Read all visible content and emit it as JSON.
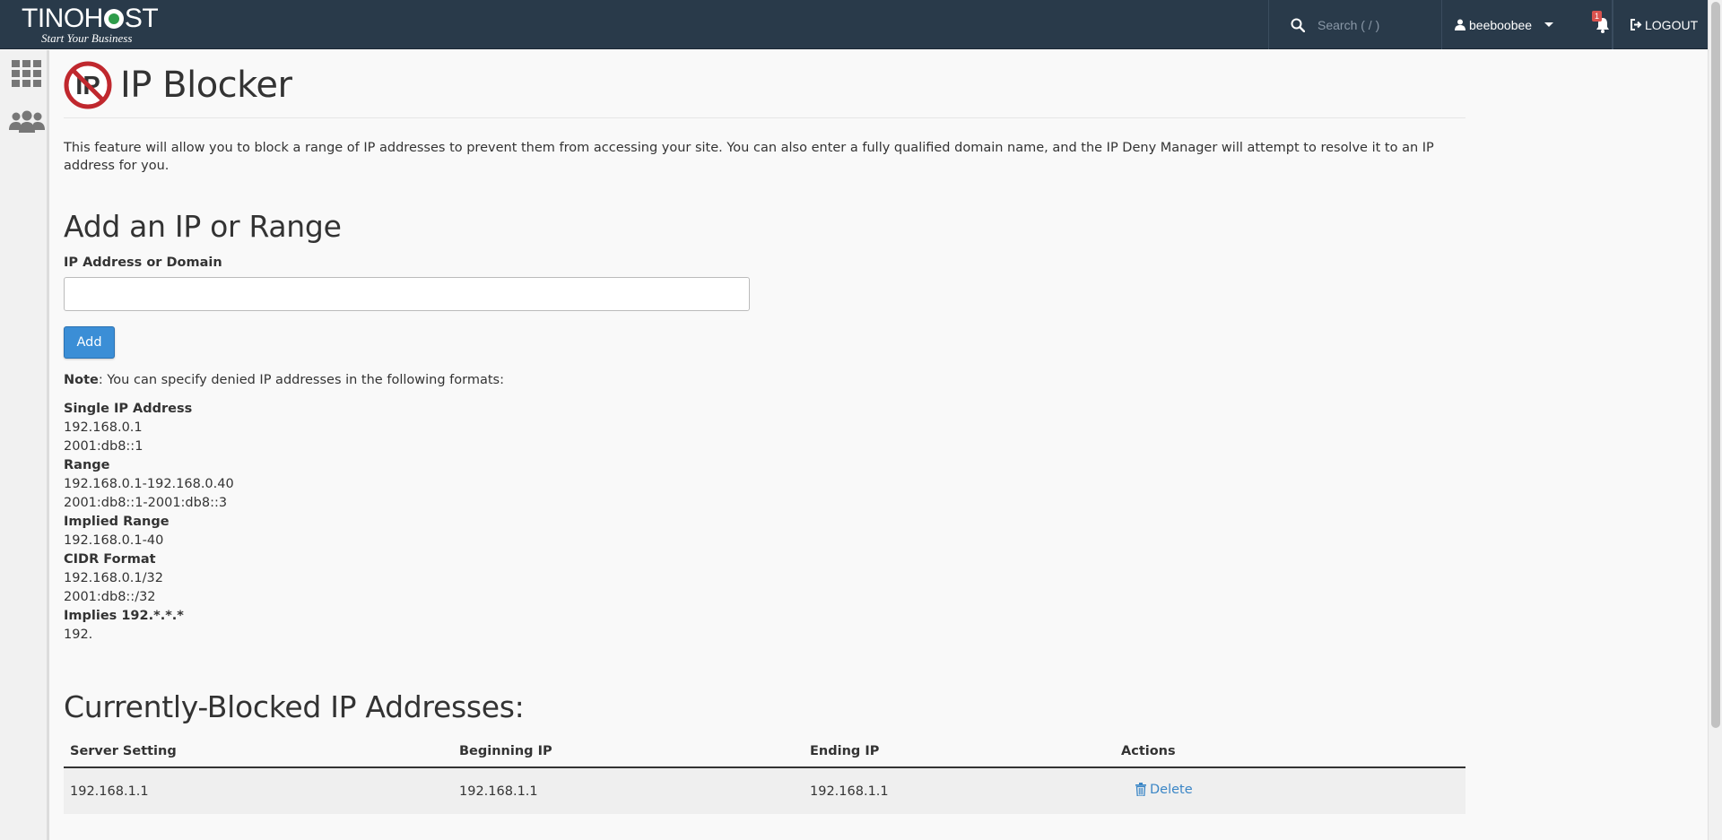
{
  "header": {
    "logo_text": "TINOHOST",
    "logo_tagline": "Start Your Business",
    "search_placeholder": "Search ( / )",
    "username": "beeboobee",
    "notification_count": "1",
    "logout_label": "LOGOUT"
  },
  "page": {
    "title": "IP Blocker",
    "description": "This feature will allow you to block a range of IP addresses to prevent them from accessing your site. You can also enter a fully qualified domain name, and the IP Deny Manager will attempt to resolve it to an IP address for you."
  },
  "form": {
    "heading": "Add an IP or Range",
    "field_label": "IP Address or Domain",
    "field_value": "",
    "add_button": "Add"
  },
  "note": {
    "label": "Note",
    "text": ": You can specify denied IP addresses in the following formats:"
  },
  "formats": [
    {
      "heading": "Single IP Address",
      "examples": [
        "192.168.0.1",
        "2001:db8::1"
      ]
    },
    {
      "heading": "Range",
      "examples": [
        "192.168.0.1-192.168.0.40",
        "2001:db8::1-2001:db8::3"
      ]
    },
    {
      "heading": "Implied Range",
      "examples": [
        "192.168.0.1-40"
      ]
    },
    {
      "heading": "CIDR Format",
      "examples": [
        "192.168.0.1/32",
        "2001:db8::/32"
      ]
    },
    {
      "heading": "Implies 192.*.*.*",
      "examples": [
        "192."
      ]
    }
  ],
  "blocked": {
    "heading": "Currently-Blocked IP Addresses:",
    "columns": [
      "Server Setting",
      "Beginning IP",
      "Ending IP",
      "Actions"
    ],
    "rows": [
      {
        "server_setting": "192.168.1.1",
        "beginning_ip": "192.168.1.1",
        "ending_ip": "192.168.1.1",
        "action": "Delete"
      }
    ]
  },
  "icons": {
    "search": "search-icon",
    "user": "user-icon",
    "bell": "bell-icon",
    "logout": "logout-icon",
    "apps": "grid-icon",
    "users": "users-icon",
    "ip_blocker": "ip-blocker-icon",
    "trash": "trash-icon"
  },
  "colors": {
    "topbar": "#293a4a",
    "primary_button": "#3b8ed6",
    "link": "#3b86c6",
    "badge": "#d9534f",
    "ip_icon_red": "#c0282e"
  }
}
